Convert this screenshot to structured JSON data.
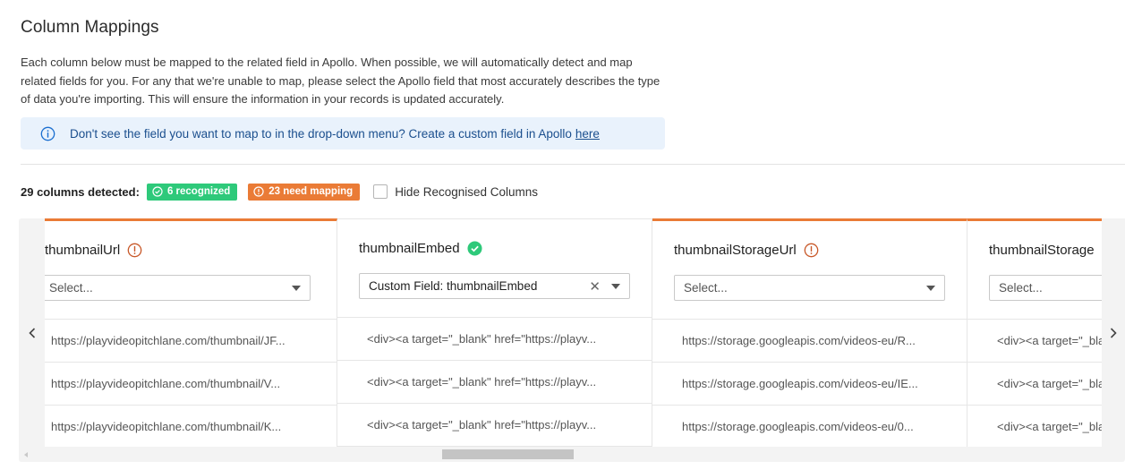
{
  "page": {
    "title": "Column Mappings",
    "description": "Each column below must be mapped to the related field in Apollo. When possible, we will automatically detect and map related fields for you. For any that we're unable to map, please select the Apollo field that most accurately describes the type of data you're importing. This will ensure the information in your records is updated accurately."
  },
  "banner": {
    "text": "Don't see the field you want to map to in the drop-down menu? Create a custom field in Apollo",
    "link": "here",
    "icon": "info-icon",
    "color": "#1b4f8e",
    "background": "#e9f2fc"
  },
  "status": {
    "detected": "29 columns detected:",
    "recognized": "6 recognized",
    "need_mapping": "23 need mapping",
    "hide_label": "Hide Recognised Columns",
    "hide_checked": false,
    "green": "#2ec97a",
    "orange": "#ea7b36"
  },
  "columns": [
    {
      "name": "thumbnailUrl",
      "status": "warning",
      "select": "Select...",
      "cells": [
        "https://playvideopitchlane.com/thumbnail/JF...",
        "https://playvideopitchlane.com/thumbnail/V...",
        "https://playvideopitchlane.com/thumbnail/K..."
      ]
    },
    {
      "name": "thumbnailEmbed",
      "status": "ok",
      "select": "Custom Field: thumbnailEmbed",
      "cells": [
        "<div><a target=\"_blank\" href=\"https://playv...",
        "<div><a target=\"_blank\" href=\"https://playv...",
        "<div><a target=\"_blank\" href=\"https://playv..."
      ]
    },
    {
      "name": "thumbnailStorageUrl",
      "status": "warning",
      "select": "Select...",
      "cells": [
        "https://storage.googleapis.com/videos-eu/R...",
        "https://storage.googleapis.com/videos-eu/IE...",
        "https://storage.googleapis.com/videos-eu/0..."
      ]
    },
    {
      "name": "thumbnailStorage",
      "status": "warning",
      "select": "Select...",
      "cells": [
        "<div><a target=\"_blank\"",
        "<div><a target=\"_blank\"",
        "<div><a target=\"_blank\""
      ]
    }
  ]
}
